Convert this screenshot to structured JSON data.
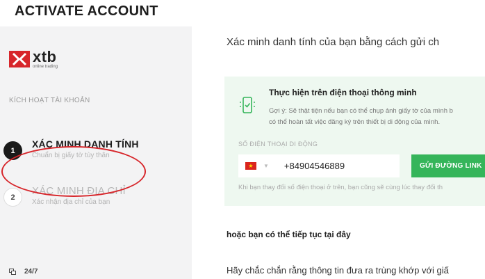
{
  "header": {
    "title": "ACTIVATE ACCOUNT"
  },
  "sidebar": {
    "logo": {
      "name": "xtb",
      "tagline": "online trading"
    },
    "section_label": "KÍCH HOẠT TÀI KHOẢN",
    "steps": [
      {
        "number": "1",
        "title": "XÁC MINH DANH TÍNH",
        "subtitle": "Chuẩn bị giấy tờ tùy thân"
      },
      {
        "number": "2",
        "title": "XÁC MINH ĐỊA CHỈ",
        "subtitle": "Xác nhận địa chỉ của bạn"
      }
    ],
    "support": "24/7"
  },
  "main": {
    "lead": "Xác minh danh tính của bạn bằng cách gửi ch",
    "panel": {
      "title": "Thực hiện trên điện thoại thông minh",
      "hint_line1": "Gợi ý: Sẽ thật tiện nếu bạn có thể chụp ảnh giấy tờ của mình b",
      "hint_line2": "có thể hoàn tất việc đăng ký trên thiết bị di động của mình.",
      "phone_label": "SỐ ĐIỆN THOẠI DI ĐỘNG",
      "phone_value": "+84904546889",
      "send_button": "GỬI ĐƯỜNG LINK",
      "note": "Khi bạn thay đổi số điện thoại ở trên, bạn cũng sẽ cùng lúc thay đổi th"
    },
    "or_continue": "hoặc bạn có thể tiếp tục tại đây",
    "confirm_text": "Hãy chắc chắn rằng thông tin đưa ra trùng khớp với giấ"
  },
  "colors": {
    "accent_green": "#35b55a",
    "highlight_red": "#d7262b",
    "flag_red": "#da251d"
  }
}
